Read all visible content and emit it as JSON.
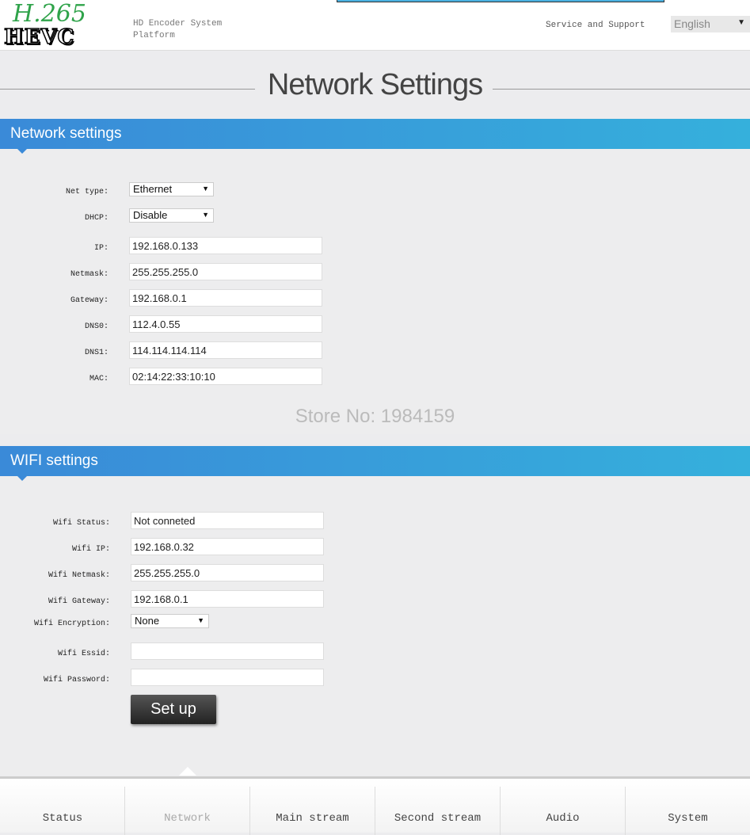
{
  "header": {
    "logo_top": "H.265",
    "logo_bottom": "HEVC",
    "subtitle_line1": "HD Encoder System",
    "subtitle_line2": "Platform",
    "service": "Service and Support",
    "language": "English"
  },
  "page_title": "Network Settings",
  "network": {
    "heading": "Network settings",
    "net_type": {
      "label": "Net type:",
      "value": "Ethernet"
    },
    "dhcp": {
      "label": "DHCP:",
      "value": "Disable"
    },
    "ip": {
      "label": "IP:",
      "value": "192.168.0.133"
    },
    "netmask": {
      "label": "Netmask:",
      "value": "255.255.255.0"
    },
    "gateway": {
      "label": "Gateway:",
      "value": "192.168.0.1"
    },
    "dns0": {
      "label": "DNS0:",
      "value": "112.4.0.55"
    },
    "dns1": {
      "label": "DNS1:",
      "value": "114.114.114.114"
    },
    "mac": {
      "label": "MAC:",
      "value": "02:14:22:33:10:10"
    }
  },
  "watermark": "Store No: 1984159",
  "wifi": {
    "heading": "WIFI settings",
    "status": {
      "label": "Wifi Status:",
      "value": "Not conneted"
    },
    "ip": {
      "label": "Wifi IP:",
      "value": "192.168.0.32"
    },
    "netmask": {
      "label": "Wifi Netmask:",
      "value": "255.255.255.0"
    },
    "gateway": {
      "label": "Wifi Gateway:",
      "value": "192.168.0.1"
    },
    "encryption": {
      "label": "Wifi Encryption:",
      "value": "None"
    },
    "essid": {
      "label": "Wifi Essid:",
      "value": ""
    },
    "password": {
      "label": "Wifi Password:",
      "value": ""
    },
    "setup": "Set up"
  },
  "nav": [
    "Status",
    "Network",
    "Main stream",
    "Second stream",
    "Audio",
    "System"
  ],
  "active_nav": "Network"
}
